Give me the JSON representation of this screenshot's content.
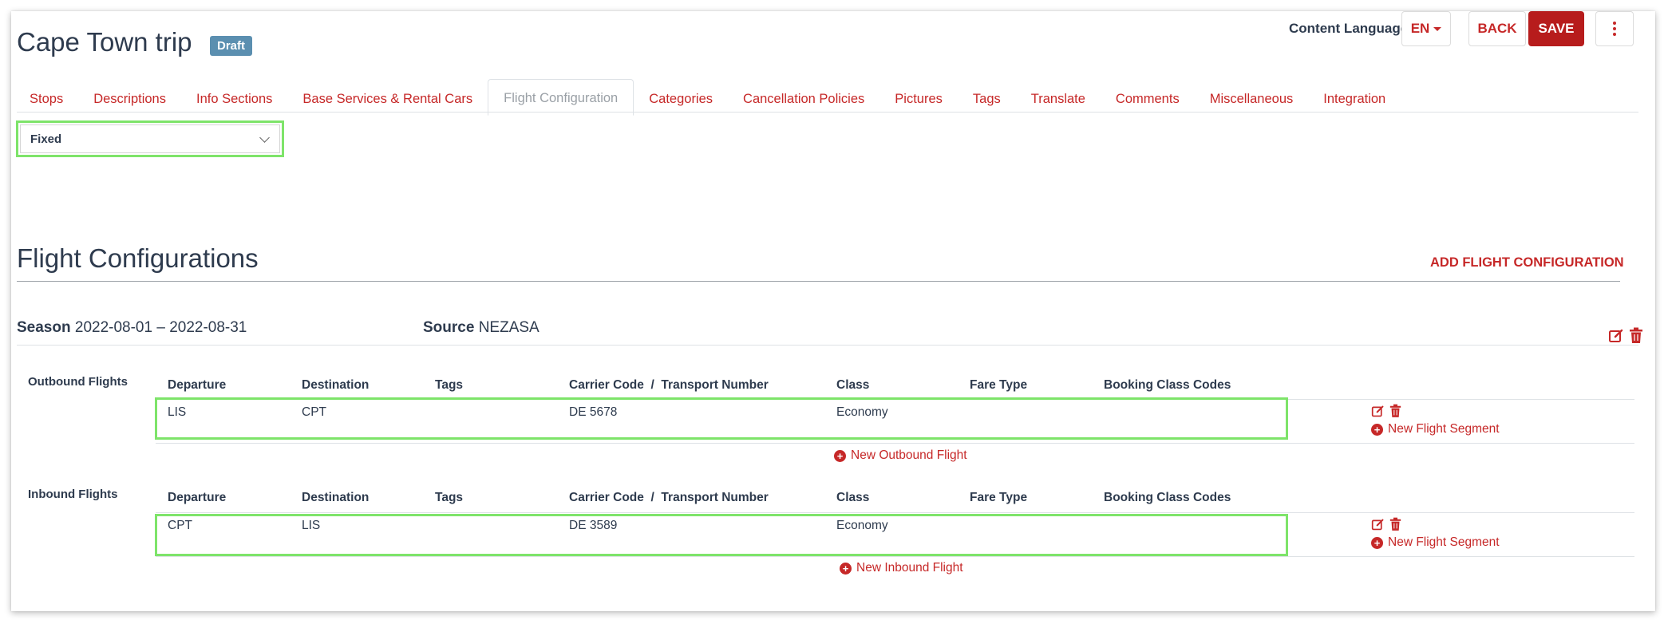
{
  "header": {
    "title": "Cape Town trip",
    "status_badge": "Draft",
    "content_language_label": "Content Language",
    "language_value": "EN",
    "back_label": "BACK",
    "save_label": "SAVE"
  },
  "tabs": [
    {
      "label": "Stops"
    },
    {
      "label": "Descriptions"
    },
    {
      "label": "Info Sections"
    },
    {
      "label": "Base Services & Rental Cars"
    },
    {
      "label": "Flight Configuration",
      "active": true
    },
    {
      "label": "Categories"
    },
    {
      "label": "Cancellation Policies"
    },
    {
      "label": "Pictures"
    },
    {
      "label": "Tags"
    },
    {
      "label": "Translate"
    },
    {
      "label": "Comments"
    },
    {
      "label": "Miscellaneous"
    },
    {
      "label": "Integration"
    }
  ],
  "mode_select": {
    "value": "Fixed"
  },
  "section": {
    "title": "Flight Configurations",
    "add_label": "ADD FLIGHT CONFIGURATION"
  },
  "configuration": {
    "season_label": "Season",
    "season_value": "2022-08-01 – 2022-08-31",
    "source_label": "Source",
    "source_value": "NEZASA"
  },
  "columns": [
    "Departure",
    "Destination",
    "Tags",
    "Carrier Code  /  Transport Number",
    "Class",
    "Fare Type",
    "Booking Class Codes"
  ],
  "outbound": {
    "label": "Outbound Flights",
    "row": {
      "departure": "LIS",
      "destination": "CPT",
      "tags": "",
      "carrier": "DE 5678",
      "class": "Economy",
      "fare_type": "",
      "booking_codes": ""
    },
    "new_segment_label": "New Flight Segment",
    "new_flight_label": "New Outbound Flight"
  },
  "inbound": {
    "label": "Inbound Flights",
    "row": {
      "departure": "CPT",
      "destination": "LIS",
      "tags": "",
      "carrier": "DE 3589",
      "class": "Economy",
      "fare_type": "",
      "booking_codes": ""
    },
    "new_segment_label": "New Flight Segment",
    "new_flight_label": "New Inbound Flight"
  },
  "colors": {
    "accent": "#c62828",
    "save": "#b71c1c",
    "badge": "#5b8fb0",
    "highlight": "#7ee46a"
  }
}
